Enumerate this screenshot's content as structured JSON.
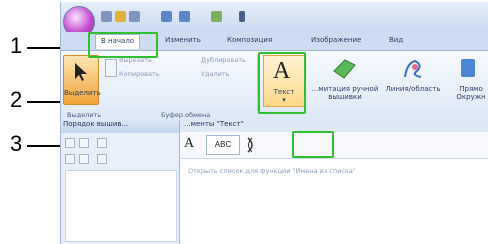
{
  "callouts": [
    "1",
    "2",
    "3"
  ],
  "tabs": [
    "В начало",
    "Изменить",
    "Композиция",
    "Изображение",
    "Вид"
  ],
  "ribbon": {
    "select_label": "Выделить",
    "cut": "Вырезать",
    "copy": "Копировать",
    "duplicate": "Дублировать",
    "delete": "Удалить",
    "text_label": "Текст",
    "manual": "...митация ручной вышивки",
    "line_area": "Линия/область",
    "rect": "Прямо Окружн",
    "group_select": "Выделить",
    "group_clipboard": "Буфер обмена"
  },
  "panel": {
    "title": "Порядок вышив..."
  },
  "tools": {
    "header": "...менты \"Текст\"",
    "abc": "ABC",
    "hint": "Открыть список для функции \"Имена из списка\""
  },
  "colors": {
    "highlight": "#2fbf2f",
    "ribbon_bg": "#dde8f6",
    "accent_orange": "#f2a33a"
  }
}
